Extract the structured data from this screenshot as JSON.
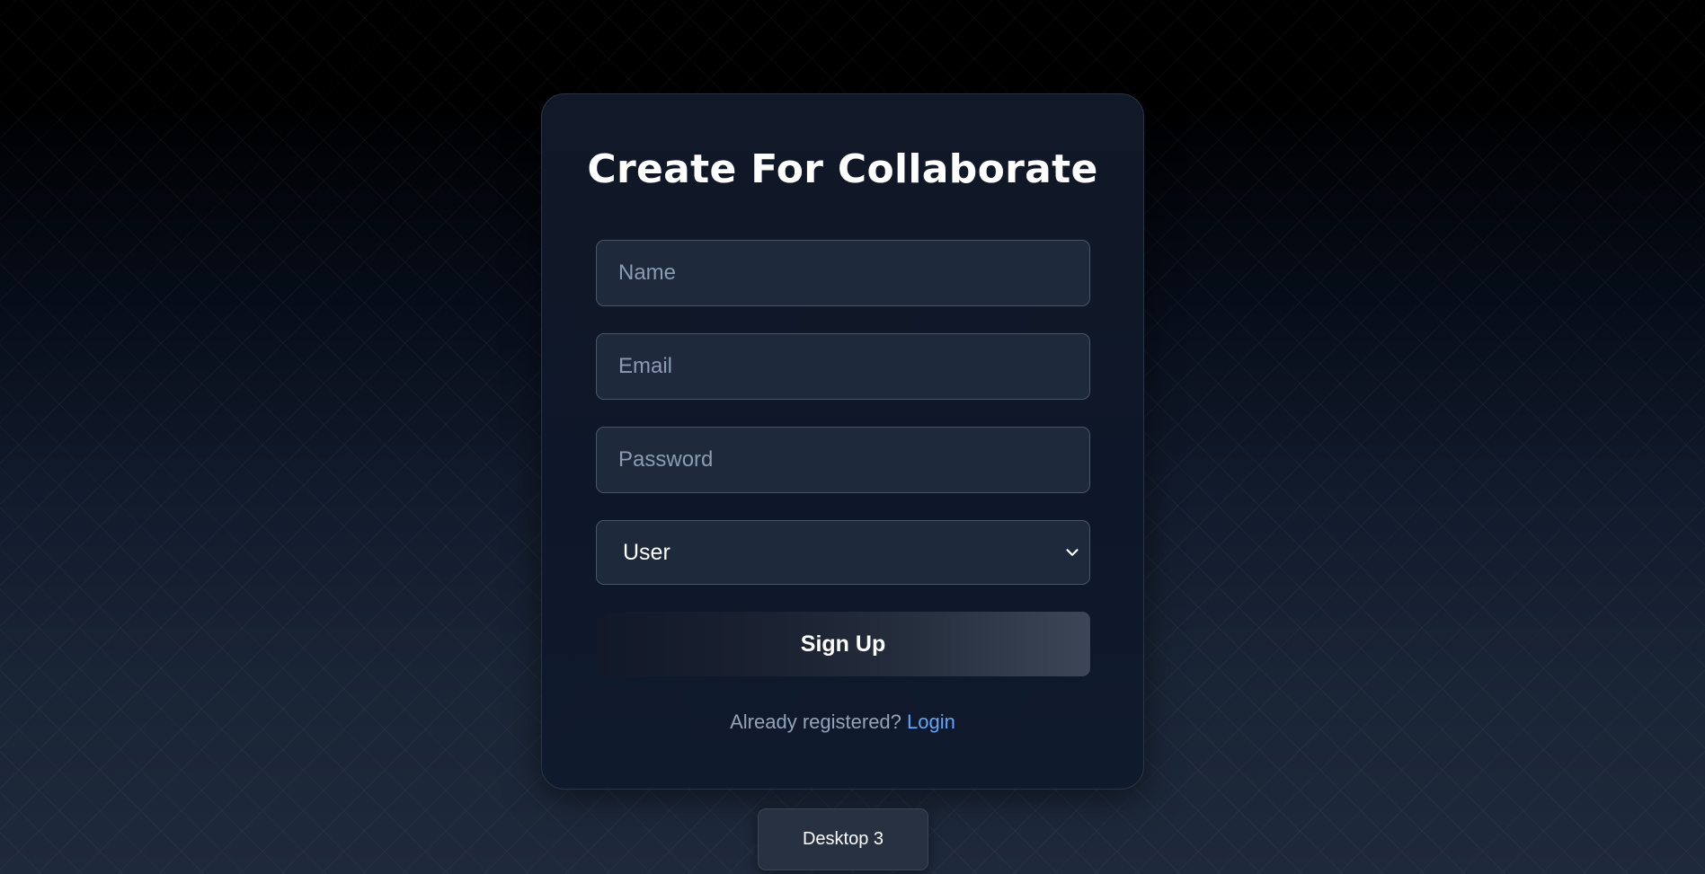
{
  "title": "Create For Collaborate",
  "form": {
    "name_placeholder": "Name",
    "email_placeholder": "Email",
    "password_placeholder": "Password",
    "role_selected": "User",
    "signup_label": "Sign Up"
  },
  "footer": {
    "prompt": "Already registered?",
    "login_label": "Login"
  },
  "badge": {
    "label": "Desktop 3"
  },
  "colors": {
    "link": "#60a5fa",
    "field_bg": "#1e293b",
    "card_bg": "#111827"
  },
  "icons": {
    "select": "chevron-down-icon"
  }
}
